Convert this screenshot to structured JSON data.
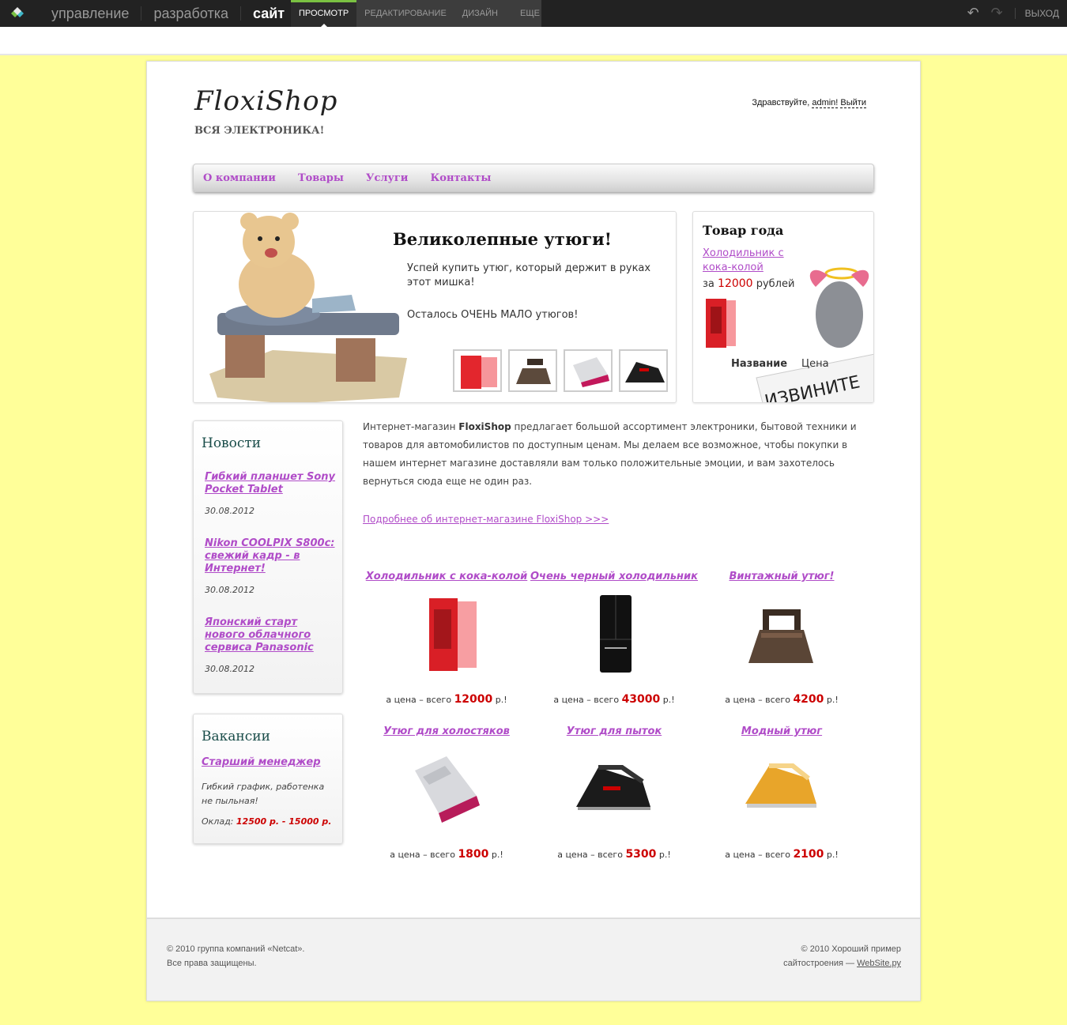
{
  "admin_bar": {
    "main_nav": [
      "управление",
      "разработка",
      "сайт"
    ],
    "sub_nav": [
      "просмотр",
      "редактирование",
      "дизайн",
      "еще"
    ],
    "exit_label": "выход",
    "accent": "#7ac142"
  },
  "site": {
    "brand": "FloxiShop",
    "tagline": "ВСЯ ЭЛЕКТРОНИКА!",
    "greeting_prefix": "Здравствуйте,",
    "greeting_user": "admin!",
    "logout": "Выйти",
    "menu": [
      "О компании",
      "Товары",
      "Услуги",
      "Контакты"
    ],
    "link_color": "#b04cc8",
    "background": "#ffff99"
  },
  "banner": {
    "title": "Великолепные утюги!",
    "text1": "Успей купить утюг, который держит в руках этот мишка!",
    "text2": "Осталось ОЧЕНЬ МАЛО утюгов!"
  },
  "product_of_year": {
    "title": "Товар года",
    "link": "Холодильник с кока-колой",
    "price_prefix": "за",
    "price": "12000",
    "price_suffix": "рублей",
    "label_name": "Название",
    "label_price": "Цена"
  },
  "news": {
    "title": "Новости",
    "items": [
      {
        "title": "Гибкий планшет Sony Pocket Tablet",
        "date": "30.08.2012"
      },
      {
        "title": "Nikon COOLPIX S800c: свежий кадр - в Интернет!",
        "date": "30.08.2012"
      },
      {
        "title": "Японский старт нового облачного сервиса Panasonic",
        "date": "30.08.2012"
      }
    ]
  },
  "vacancies": {
    "title": "Вакансии",
    "job": "Старший менеджер",
    "desc": "Гибкий график, работенка не пыльная!",
    "salary_label": "Оклад:",
    "salary": "12500 р.  - 15000 р."
  },
  "intro": {
    "part1": "Интернет-магазин ",
    "brand": "FloxiShop",
    "part2": " предлагает большой ассортимент электроники, бытовой техники и товаров для автомобилистов по доступным ценам. Мы делаем все возможное, чтобы покупки в нашем интернет магазине доставляли вам только положительные эмоции, и вам захотелось вернуться сюда еще не один раз.",
    "more_link": "Подробнее об интернет-магазине FloxiShop >>>"
  },
  "goods": {
    "price_prefix": "а цена – всего",
    "price_suffix": "р.!",
    "items": [
      {
        "name": "Холодильник с кока-колой",
        "price": "12000",
        "icon": "red-fridge"
      },
      {
        "name": "Очень черный холодильник",
        "price": "43000",
        "icon": "black-fridge"
      },
      {
        "name": "Винтажный утюг!",
        "price": "4200",
        "icon": "vintage-iron"
      },
      {
        "name": "Утюг для холостяков",
        "price": "1800",
        "icon": "pink-iron"
      },
      {
        "name": "Утюг для пыток",
        "price": "5300",
        "icon": "black-iron"
      },
      {
        "name": "Модный утюг",
        "price": "2100",
        "icon": "yellow-iron"
      }
    ]
  },
  "footer": {
    "left1": "© 2010 группа компаний «Netcat».",
    "left2": "Все права защищены.",
    "right1": "© 2010 Хороший пример",
    "right2": "сайтостроения —",
    "right_link": "WebSite.ру"
  }
}
